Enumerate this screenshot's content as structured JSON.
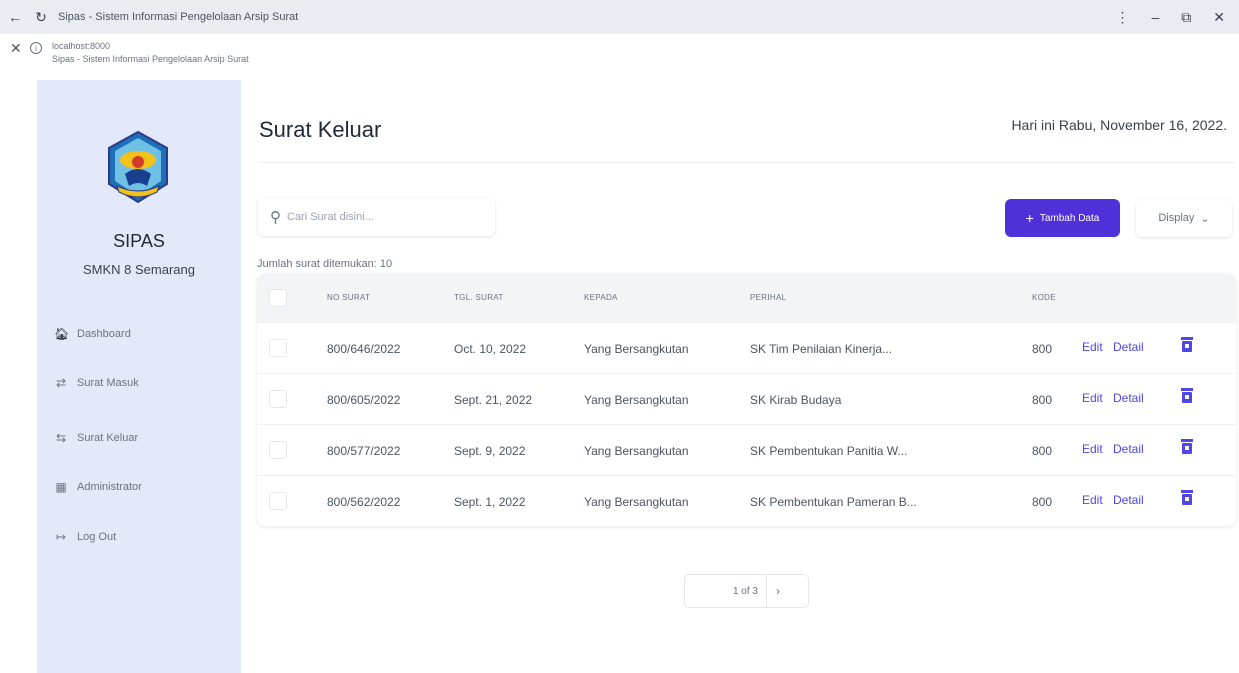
{
  "browser": {
    "window_title": "Sipas - Sistem Informasi Pengelolaan Arsip Surat",
    "url": "localhost:8000",
    "page_title": "Sipas - Sistem Informasi Pengelolaan Arsip Surat"
  },
  "sidebar": {
    "brand": "SIPAS",
    "school": "SMKN 8 Semarang",
    "items": [
      {
        "label": "Dashboard",
        "icon": "home-icon"
      },
      {
        "label": "Surat Masuk",
        "icon": "inbox-icon"
      },
      {
        "label": "Surat Keluar",
        "icon": "outbox-icon"
      },
      {
        "label": "Administrator",
        "icon": "admin-icon"
      },
      {
        "label": "Log Out",
        "icon": "logout-icon"
      }
    ]
  },
  "main": {
    "title": "Surat Keluar",
    "date": "Hari ini Rabu, November 16, 2022.",
    "search_placeholder": "Cari Surat disini...",
    "add_button": "Tambah Data",
    "display_button": "Display",
    "count_text": "Jumlah surat ditemukan: 10"
  },
  "table": {
    "columns": [
      "NO SURAT",
      "TGL. SURAT",
      "KEPADA",
      "PERIHAL",
      "KODE"
    ],
    "rows": [
      {
        "no": "800/646/2022",
        "tgl": "Oct. 10, 2022",
        "kepada": "Yang Bersangkutan",
        "perihal": "SK Tim Penilaian Kinerja...",
        "kode": "800"
      },
      {
        "no": "800/605/2022",
        "tgl": "Sept. 21, 2022",
        "kepada": "Yang Bersangkutan",
        "perihal": "SK Kirab Budaya",
        "kode": "800"
      },
      {
        "no": "800/577/2022",
        "tgl": "Sept. 9, 2022",
        "kepada": "Yang Bersangkutan",
        "perihal": "SK Pembentukan Panitia W...",
        "kode": "800"
      },
      {
        "no": "800/562/2022",
        "tgl": "Sept. 1, 2022",
        "kepada": "Yang Bersangkutan",
        "perihal": "SK Pembentukan Pameran B...",
        "kode": "800"
      }
    ],
    "edit_label": "Edit",
    "detail_label": "Detail"
  },
  "pagination": {
    "label": "1 of 3"
  },
  "colors": {
    "accent": "#4f31d9",
    "sidebar_bg": "#e4e8fb",
    "link": "#4f46e5"
  }
}
